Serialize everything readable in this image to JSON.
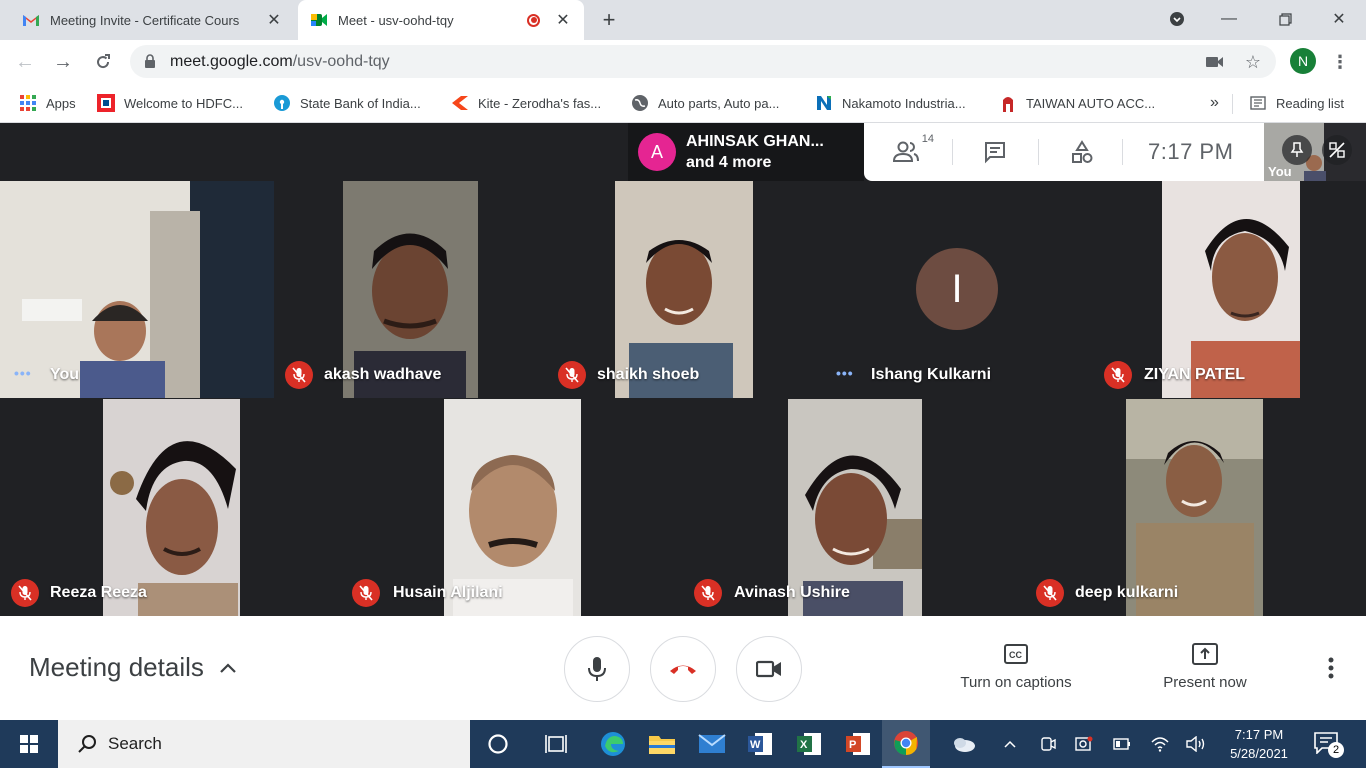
{
  "browser": {
    "tabs": [
      {
        "title": "Meeting Invite - Certificate Cours",
        "icon": "gmail-icon",
        "active": false
      },
      {
        "title": "Meet - usv-oohd-tqy",
        "icon": "meet-icon",
        "active": true
      }
    ],
    "url_host": "meet.google.com",
    "url_path": "/usv-oohd-tqy",
    "profile_initial": "N",
    "bookmarks": [
      {
        "label": "Apps",
        "icon": "apps-grid-icon"
      },
      {
        "label": "Welcome to HDFC...",
        "icon": "hdfc-icon"
      },
      {
        "label": "State Bank of India...",
        "icon": "sbi-icon"
      },
      {
        "label": "Kite - Zerodha's fas...",
        "icon": "kite-icon"
      },
      {
        "label": "Auto parts, Auto pa...",
        "icon": "globe-icon"
      },
      {
        "label": "Nakamoto Industria...",
        "icon": "nakamoto-icon"
      },
      {
        "label": "TAIWAN AUTO ACC...",
        "icon": "taiwan-icon"
      }
    ],
    "overflow": "»",
    "reading_list": "Reading list"
  },
  "meet": {
    "presenter": {
      "initial": "A",
      "line1": "AHINSAK GHAN...",
      "line2": "and 4 more"
    },
    "people_count": "14",
    "time": "7:17  PM",
    "self_label": "You",
    "participants": [
      {
        "name": "You",
        "muted": false
      },
      {
        "name": "akash wadhave",
        "muted": true
      },
      {
        "name": "shaikh shoeb",
        "muted": true
      },
      {
        "name": "Ishang Kulkarni",
        "muted": false,
        "initial": "I"
      },
      {
        "name": "ZIYAN PATEL",
        "muted": true
      },
      {
        "name": "Reeza Reeza",
        "muted": true
      },
      {
        "name": "Husain Aljilani",
        "muted": true
      },
      {
        "name": "Avinash Ushire",
        "muted": true
      },
      {
        "name": "deep kulkarni",
        "muted": true
      }
    ],
    "controls": {
      "meeting_details": "Meeting details",
      "captions": "Turn on captions",
      "present": "Present now"
    }
  },
  "taskbar": {
    "search": "Search",
    "time": "7:17 PM",
    "date": "5/28/2021",
    "notifications": "2"
  },
  "colors": {
    "meet_dark": "#202124",
    "mute_red": "#d93025",
    "presenter_pink": "#e52592",
    "avatar_brown": "#6d4c41",
    "speaking_dots": "#8ab4f8",
    "taskbar": "#1f3a5a"
  }
}
